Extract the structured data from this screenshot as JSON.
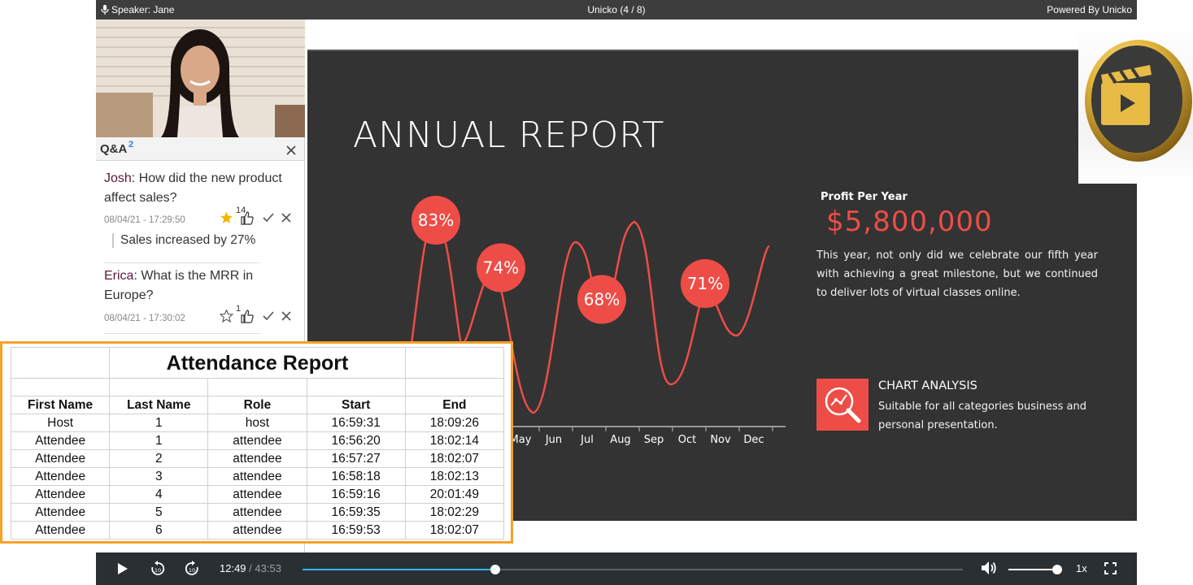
{
  "topbar": {
    "speaker": "Speaker: Jane",
    "title": "Unicko (4 / 8)",
    "powered": "Powered By Unicko"
  },
  "qa": {
    "title": "Q&A",
    "count": "2",
    "questions": [
      {
        "author": "Josh",
        "text": ": How did the new product affect sales?",
        "time": "08/04/21 - 17:29:50",
        "likes": "14",
        "starred": true,
        "answer": "Sales increased by 27%"
      },
      {
        "author": "Erica",
        "text": ": What is the MRR in Europe?",
        "time": "08/04/21 - 17:30:02",
        "likes": "1",
        "starred": false
      }
    ]
  },
  "slide": {
    "title": "ANNUAL REPORT",
    "profit_label": "Profit Per Year",
    "profit_value": "$5,800,000",
    "profit_text": "This year, not only did we celebrate our fifth year with achieving a great milestone, but we continued to deliver lots of virtual classes online.",
    "analysis_title": "CHART ANALYSIS",
    "analysis_text": "Suitable for all categories business and personal presentation.",
    "accent": "#ee4d47",
    "background": "#333333"
  },
  "chart_data": {
    "type": "line",
    "categories": [
      "May",
      "Jun",
      "Jul",
      "Aug",
      "Sep",
      "Oct",
      "Nov",
      "Dec"
    ],
    "bubbles": [
      {
        "label": "83%",
        "value": 83
      },
      {
        "label": "74%",
        "value": 74
      },
      {
        "label": "68%",
        "value": 68
      },
      {
        "label": "71%",
        "value": 71
      }
    ]
  },
  "attendance": {
    "title": "Attendance Report",
    "columns": [
      "First Name",
      "Last Name",
      "Role",
      "Start",
      "End"
    ],
    "rows": [
      [
        "Host",
        "1",
        "host",
        "16:59:31",
        "18:09:26"
      ],
      [
        "Attendee",
        "1",
        "attendee",
        "16:56:20",
        "18:02:14"
      ],
      [
        "Attendee",
        "2",
        "attendee",
        "16:57:27",
        "18:02:07"
      ],
      [
        "Attendee",
        "3",
        "attendee",
        "16:58:18",
        "18:02:13"
      ],
      [
        "Attendee",
        "4",
        "attendee",
        "16:59:16",
        "20:01:49"
      ],
      [
        "Attendee",
        "5",
        "attendee",
        "16:59:35",
        "18:02:29"
      ],
      [
        "Attendee",
        "6",
        "attendee",
        "16:59:53",
        "18:02:07"
      ]
    ]
  },
  "player": {
    "current_time": "12:49",
    "total_time": "43:53",
    "separator": " / ",
    "speed": "1x",
    "progress_fraction": 0.292,
    "volume_fraction": 1.0,
    "icons": [
      "play-icon",
      "rewind-10-icon",
      "forward-10-icon",
      "volume-icon",
      "fullscreen-icon"
    ]
  }
}
